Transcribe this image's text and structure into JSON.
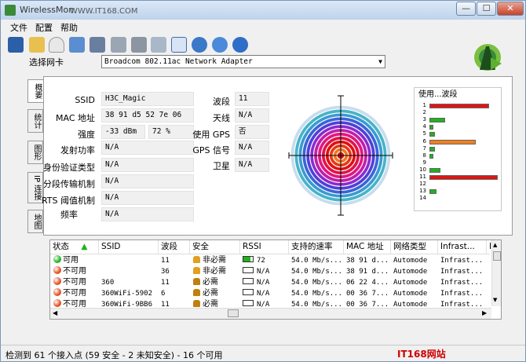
{
  "window": {
    "title": "WirelessMon",
    "watermark": "WWW.IT168.COM",
    "min": "—",
    "max": "☐",
    "close": "✕"
  },
  "menu": [
    "文件",
    "配置",
    "帮助"
  ],
  "adapter": {
    "label": "选择网卡",
    "value": "Broadcom 802.11ac Network Adapter"
  },
  "tabs": [
    "概要",
    "统计",
    "图形",
    "IP 连接",
    "地图"
  ],
  "summary": {
    "ssid_label": "SSID",
    "ssid": "H3C_Magic",
    "mac_label": "MAC 地址",
    "mac": "38 91 d5 52 7e 06",
    "strength_label": "强度",
    "strength_dbm": "-33 dBm",
    "strength_pct": "72 %",
    "tx_label": "发射功率",
    "tx": "N/A",
    "auth_label": "身份验证类型",
    "auth": "N/A",
    "frag_label": "分段传输机制",
    "frag": "N/A",
    "rts_label": "RTS 阈值机制",
    "rts": "N/A",
    "freq_label": "频率",
    "freq": "N/A",
    "band_label": "波段",
    "band": "11",
    "antenna_label": "天线",
    "antenna": "N/A",
    "gps_label": "使用 GPS",
    "gps": "否",
    "gps_signal_label": "GPS 信号",
    "gps_signal": "N/A",
    "sat_label": "卫星",
    "sat": "N/A"
  },
  "channel_usage": {
    "title": "使用...波段",
    "channels": [
      {
        "ch": "1",
        "level": 0.84,
        "color": "#e01414"
      },
      {
        "ch": "2",
        "level": 0,
        "color": "#1fb21f"
      },
      {
        "ch": "3",
        "level": 0.22,
        "color": "#1fb21f"
      },
      {
        "ch": "4",
        "level": 0.05,
        "color": "#1fb21f"
      },
      {
        "ch": "5",
        "level": 0.08,
        "color": "#1fb21f"
      },
      {
        "ch": "6",
        "level": 0.66,
        "color": "#f08020"
      },
      {
        "ch": "7",
        "level": 0.08,
        "color": "#1fb21f"
      },
      {
        "ch": "8",
        "level": 0.05,
        "color": "#1fb21f"
      },
      {
        "ch": "9",
        "level": 0,
        "color": "#1fb21f"
      },
      {
        "ch": "10",
        "level": 0.15,
        "color": "#1fb21f"
      },
      {
        "ch": "11",
        "level": 0.97,
        "color": "#e01414"
      },
      {
        "ch": "12",
        "level": 0,
        "color": "#1fb21f"
      },
      {
        "ch": "13",
        "level": 0.1,
        "color": "#1fb21f"
      },
      {
        "ch": "14",
        "level": 0,
        "color": "#1fb21f"
      }
    ]
  },
  "list": {
    "columns": [
      "状态",
      "SSID",
      "波段",
      "安全",
      "RSSI",
      "支持的速率",
      "MAC 地址",
      "网络类型",
      "Infrast...",
      "I"
    ],
    "rows": [
      {
        "status": "可用",
        "status_color": "#1fb21f",
        "ssid": "",
        "band": "11",
        "security": "非必需",
        "lock_color": "#e0a020",
        "rssi": "72",
        "rssi_level": 0.72,
        "rate": "54.0 Mb/s...",
        "mac": "38 91 d...",
        "nettype": "Automode",
        "infra": "Infrast..."
      },
      {
        "status": "不可用",
        "status_color": "#e05020",
        "ssid": "",
        "band": "36",
        "security": "非必需",
        "lock_color": "#e0a020",
        "rssi": "N/A",
        "rssi_level": 0,
        "rate": "54.0 Mb/s...",
        "mac": "38 91 d...",
        "nettype": "Automode",
        "infra": "Infrast..."
      },
      {
        "status": "不可用",
        "status_color": "#e05020",
        "ssid": "360",
        "band": "11",
        "security": "必需",
        "lock_color": "#c08010",
        "rssi": "N/A",
        "rssi_level": 0,
        "rate": "54.0 Mb/s...",
        "mac": "06 22 4...",
        "nettype": "Automode",
        "infra": "Infrast..."
      },
      {
        "status": "不可用",
        "status_color": "#e05020",
        "ssid": "360WiFi-5902",
        "band": "6",
        "security": "必需",
        "lock_color": "#c08010",
        "rssi": "N/A",
        "rssi_level": 0,
        "rate": "54.0 Mb/s...",
        "mac": "00 36 7...",
        "nettype": "Automode",
        "infra": "Infrast..."
      },
      {
        "status": "不可用",
        "status_color": "#e05020",
        "ssid": "360WiFi-9BB6",
        "band": "11",
        "security": "必需",
        "lock_color": "#c08010",
        "rssi": "N/A",
        "rssi_level": 0,
        "rate": "54.0 Mb/s...",
        "mac": "00 36 7...",
        "nettype": "Automode",
        "infra": "Infrast..."
      }
    ]
  },
  "status": "检测到 61 个接入点 (59 安全 - 2 未知安全) - 16 个可用",
  "brand": "IT168网站 WWW.IT168.COM"
}
